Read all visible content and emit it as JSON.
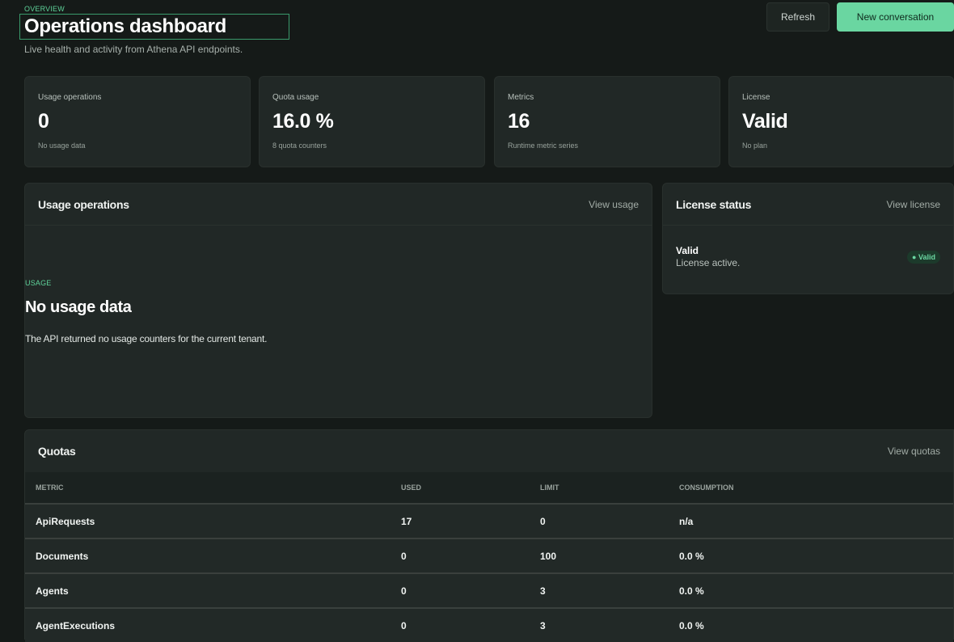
{
  "header": {
    "eyebrow": "OVERVIEW",
    "title": "Operations dashboard",
    "subtitle": "Live health and activity from Athena API endpoints.",
    "refresh_label": "Refresh",
    "new_conversation_label": "New conversation"
  },
  "stats": [
    {
      "label": "Usage operations",
      "value": "0",
      "hint": "No usage data"
    },
    {
      "label": "Quota usage",
      "value": "16.0 %",
      "hint": "8 quota counters"
    },
    {
      "label": "Metrics",
      "value": "16",
      "hint": "Runtime metric series"
    },
    {
      "label": "License",
      "value": "Valid",
      "hint": "No plan"
    }
  ],
  "usage_panel": {
    "title": "Usage operations",
    "link": "View usage",
    "eyebrow": "USAGE",
    "empty_title": "No usage data",
    "empty_text": "The API returned no usage counters for the current tenant."
  },
  "license_panel": {
    "title": "License status",
    "link": "View license",
    "value": "Valid",
    "subtext": "License active.",
    "badge": "● Valid"
  },
  "quotas_panel": {
    "title": "Quotas",
    "link": "View quotas",
    "columns": [
      "METRIC",
      "USED",
      "LIMIT",
      "CONSUMPTION"
    ],
    "rows": [
      [
        "ApiRequests",
        "17",
        "0",
        "n/a"
      ],
      [
        "Documents",
        "0",
        "100",
        "0.0 %"
      ],
      [
        "Agents",
        "0",
        "3",
        "0.0 %"
      ],
      [
        "AgentExecutions",
        "0",
        "3",
        "0.0 %"
      ]
    ]
  }
}
